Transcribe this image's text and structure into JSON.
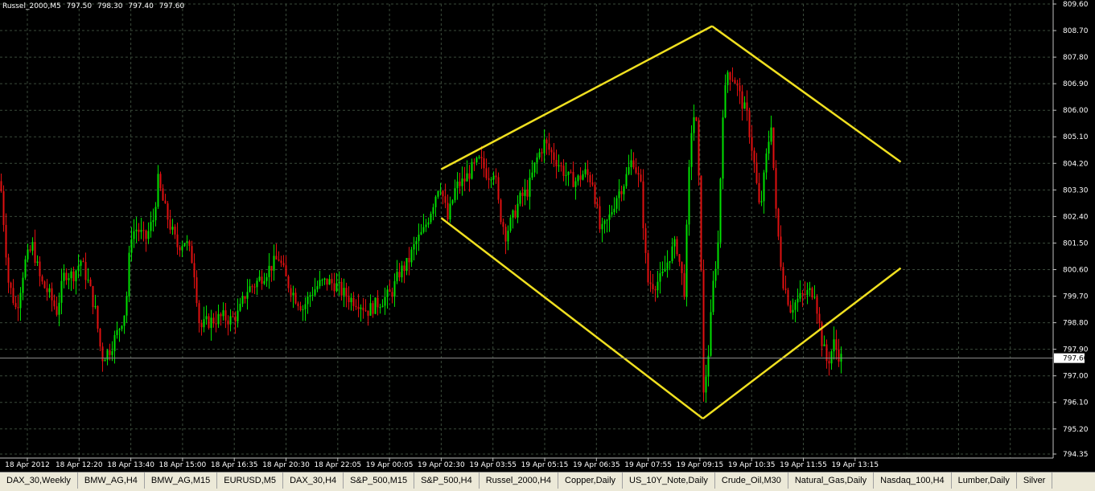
{
  "header": {
    "symbol": "Russel_2000,M5",
    "open": "797.50",
    "high": "798.30",
    "low": "797.40",
    "close": "797.60"
  },
  "current_price": "797.60",
  "colors": {
    "background": "#000000",
    "grid": "#3a4a3a",
    "bull": "#00e000",
    "bear": "#e01010",
    "trendline": "#f0e020",
    "axis_text": "#ffffff",
    "price_line": "#909090"
  },
  "tabs": [
    {
      "label": "DAX_30,Weekly"
    },
    {
      "label": "BMW_AG,H4"
    },
    {
      "label": "BMW_AG,M15"
    },
    {
      "label": "EURUSD,M5"
    },
    {
      "label": "DAX_30,H4"
    },
    {
      "label": "S&P_500,M15"
    },
    {
      "label": "S&P_500,H4"
    },
    {
      "label": "Russel_2000,H4"
    },
    {
      "label": "Copper,Daily"
    },
    {
      "label": "US_10Y_Note,Daily"
    },
    {
      "label": "Crude_Oil,M30"
    },
    {
      "label": "Natural_Gas,Daily"
    },
    {
      "label": "Nasdaq_100,H4"
    },
    {
      "label": "Lumber,Daily"
    },
    {
      "label": "Silver"
    }
  ],
  "chart_data": {
    "type": "candlestick",
    "price_axis": [
      "809.60",
      "808.70",
      "807.80",
      "806.90",
      "806.00",
      "805.10",
      "804.20",
      "803.30",
      "802.40",
      "801.50",
      "800.60",
      "799.70",
      "798.80",
      "797.90",
      "797.00",
      "796.10",
      "795.20",
      "794.35"
    ],
    "time_axis": [
      "18 Apr 2012",
      "18 Apr 12:20",
      "18 Apr 13:40",
      "18 Apr 15:00",
      "18 Apr 16:35",
      "18 Apr 20:30",
      "18 Apr 22:05",
      "19 Apr 00:05",
      "19 Apr 02:30",
      "19 Apr 03:55",
      "19 Apr 05:15",
      "19 Apr 06:35",
      "19 Apr 07:55",
      "19 Apr 09:15",
      "19 Apr 10:35",
      "19 Apr 11:55",
      "19 Apr 13:15"
    ],
    "ylim": [
      794.35,
      809.6
    ],
    "grid": true,
    "candles_path": [
      [
        0,
        803.6
      ],
      [
        10,
        800.2
      ],
      [
        20,
        799.2
      ],
      [
        30,
        800.8
      ],
      [
        40,
        801.4
      ],
      [
        50,
        800.2
      ],
      [
        60,
        799.8
      ],
      [
        70,
        799.2
      ],
      [
        80,
        800.5
      ],
      [
        90,
        800.4
      ],
      [
        100,
        800.9
      ],
      [
        110,
        800.1
      ],
      [
        118,
        799.2
      ],
      [
        126,
        797.6
      ],
      [
        136,
        797.9
      ],
      [
        146,
        798.5
      ],
      [
        156,
        799.3
      ],
      [
        162,
        801.8
      ],
      [
        170,
        802.0
      ],
      [
        180,
        801.6
      ],
      [
        190,
        802.3
      ],
      [
        196,
        803.6
      ],
      [
        204,
        802.7
      ],
      [
        212,
        802.0
      ],
      [
        220,
        801.4
      ],
      [
        230,
        801.6
      ],
      [
        240,
        800.8
      ],
      [
        248,
        798.6
      ],
      [
        256,
        798.8
      ],
      [
        266,
        798.9
      ],
      [
        276,
        799.0
      ],
      [
        286,
        798.9
      ],
      [
        296,
        799.1
      ],
      [
        306,
        799.9
      ],
      [
        316,
        800.1
      ],
      [
        326,
        800.4
      ],
      [
        336,
        800.7
      ],
      [
        346,
        801.0
      ],
      [
        356,
        800.2
      ],
      [
        366,
        799.7
      ],
      [
        376,
        799.3
      ],
      [
        386,
        799.8
      ],
      [
        396,
        800.1
      ],
      [
        406,
        800.2
      ],
      [
        416,
        800.1
      ],
      [
        426,
        799.8
      ],
      [
        436,
        799.6
      ],
      [
        446,
        799.5
      ],
      [
        456,
        799.2
      ],
      [
        466,
        799.4
      ],
      [
        476,
        799.6
      ],
      [
        486,
        799.8
      ],
      [
        496,
        800.5
      ],
      [
        506,
        800.8
      ],
      [
        516,
        801.5
      ],
      [
        526,
        801.9
      ],
      [
        536,
        802.7
      ],
      [
        546,
        803.6
      ],
      [
        556,
        802.3
      ],
      [
        566,
        803.4
      ],
      [
        576,
        803.6
      ],
      [
        586,
        804.0
      ],
      [
        596,
        804.3
      ],
      [
        606,
        803.8
      ],
      [
        614,
        804.0
      ],
      [
        620,
        802.6
      ],
      [
        628,
        801.8
      ],
      [
        636,
        802.3
      ],
      [
        646,
        803.0
      ],
      [
        656,
        803.3
      ],
      [
        666,
        804.3
      ],
      [
        676,
        804.9
      ],
      [
        686,
        804.5
      ],
      [
        696,
        804.1
      ],
      [
        706,
        803.7
      ],
      [
        716,
        803.6
      ],
      [
        726,
        803.9
      ],
      [
        736,
        803.6
      ],
      [
        746,
        801.8
      ],
      [
        756,
        802.3
      ],
      [
        766,
        803.1
      ],
      [
        776,
        803.6
      ],
      [
        786,
        804.4
      ],
      [
        796,
        803.4
      ],
      [
        804,
        800.2
      ],
      [
        812,
        800.1
      ],
      [
        822,
        800.3
      ],
      [
        832,
        801.1
      ],
      [
        840,
        801.5
      ],
      [
        850,
        799.9
      ],
      [
        858,
        805.2
      ],
      [
        864,
        806.1
      ],
      [
        870,
        802.3
      ],
      [
        874,
        796.3
      ],
      [
        880,
        797.8
      ],
      [
        886,
        800.1
      ],
      [
        892,
        801.5
      ],
      [
        898,
        806.0
      ],
      [
        904,
        807.3
      ],
      [
        912,
        807.1
      ],
      [
        920,
        806.4
      ],
      [
        928,
        805.8
      ],
      [
        936,
        804.4
      ],
      [
        944,
        802.5
      ],
      [
        952,
        804.4
      ],
      [
        958,
        805.6
      ],
      [
        964,
        802.5
      ],
      [
        972,
        800.3
      ],
      [
        982,
        799.3
      ],
      [
        992,
        799.6
      ],
      [
        1002,
        799.8
      ],
      [
        1012,
        799.9
      ],
      [
        1020,
        798.3
      ],
      [
        1028,
        797.4
      ],
      [
        1036,
        798.1
      ],
      [
        1044,
        797.6
      ]
    ],
    "trendlines": [
      {
        "from": [
          "19 Apr 02:30",
          804.0
        ],
        "to": [
          "19 Apr 09:55",
          808.85
        ]
      },
      {
        "from": [
          "19 Apr 09:55",
          808.85
        ],
        "to": [
          "19 Apr 15:05",
          804.25
        ]
      },
      {
        "from": [
          "19 Apr 02:30",
          802.35
        ],
        "to": [
          "19 Apr 09:40",
          795.55
        ]
      },
      {
        "from": [
          "19 Apr 09:40",
          795.55
        ],
        "to": [
          "19 Apr 15:05",
          800.65
        ]
      }
    ]
  }
}
